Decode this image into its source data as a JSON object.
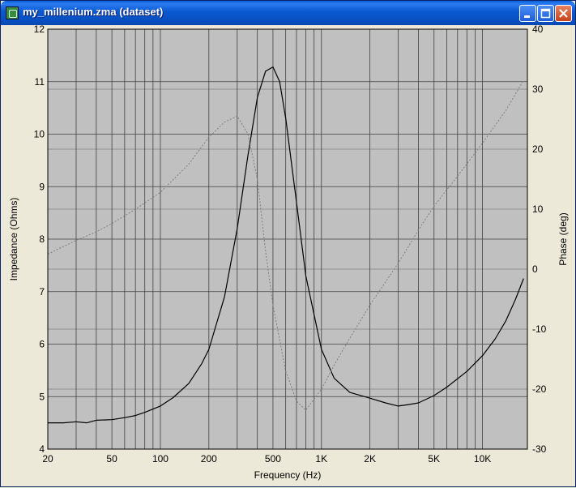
{
  "window": {
    "title": "my_millenium.zma (dataset)",
    "icons": [
      "app-icon",
      "minimize-icon",
      "maximize-icon",
      "close-icon"
    ]
  },
  "colors": {
    "plot_bg": "#C0C0C0",
    "grid": "#404040",
    "impedance_line": "#000000",
    "phase_line": "#808080",
    "titlebar": "#0A58D0"
  },
  "chart_data": {
    "type": "line",
    "xlabel": "Frequency (Hz)",
    "ylabel": "Impedance (Ohms)",
    "y2label": "Phase (deg)",
    "x_scale": "log",
    "xlim": [
      20,
      19000
    ],
    "ylim": [
      4,
      12
    ],
    "y2lim": [
      -30,
      40
    ],
    "grid": true,
    "x_ticks": [
      {
        "v": 20,
        "label": "20"
      },
      {
        "v": 50,
        "label": "50"
      },
      {
        "v": 100,
        "label": "100"
      },
      {
        "v": 200,
        "label": "200"
      },
      {
        "v": 500,
        "label": "500"
      },
      {
        "v": 1000,
        "label": "1K"
      },
      {
        "v": 2000,
        "label": "2K"
      },
      {
        "v": 5000,
        "label": "5K"
      },
      {
        "v": 10000,
        "label": "10K"
      }
    ],
    "y_ticks": [
      {
        "v": 4,
        "label": "4"
      },
      {
        "v": 5,
        "label": "5"
      },
      {
        "v": 6,
        "label": "6"
      },
      {
        "v": 7,
        "label": "7"
      },
      {
        "v": 8,
        "label": "8"
      },
      {
        "v": 9,
        "label": "9"
      },
      {
        "v": 10,
        "label": "10"
      },
      {
        "v": 11,
        "label": "11"
      },
      {
        "v": 12,
        "label": "12"
      }
    ],
    "y2_ticks": [
      {
        "v": -30,
        "label": "-30"
      },
      {
        "v": -20,
        "label": "-20"
      },
      {
        "v": -10,
        "label": "-10"
      },
      {
        "v": 0,
        "label": "0"
      },
      {
        "v": 10,
        "label": "10"
      },
      {
        "v": 20,
        "label": "20"
      },
      {
        "v": 30,
        "label": "30"
      },
      {
        "v": 40,
        "label": "40"
      }
    ],
    "series": [
      {
        "axis": "left",
        "style": "solid",
        "x": [
          20,
          25,
          30,
          35,
          40,
          50,
          60,
          70,
          80,
          100,
          120,
          150,
          180,
          200,
          250,
          300,
          350,
          400,
          450,
          500,
          550,
          600,
          700,
          800,
          1000,
          1200,
          1500,
          2000,
          2500,
          3000,
          3500,
          4000,
          5000,
          6000,
          8000,
          10000,
          12000,
          14000,
          16000,
          18000
        ],
        "y": [
          4.5,
          4.5,
          4.52,
          4.5,
          4.55,
          4.56,
          4.6,
          4.64,
          4.7,
          4.82,
          4.98,
          5.25,
          5.62,
          5.9,
          6.9,
          8.2,
          9.6,
          10.7,
          11.2,
          11.28,
          11.0,
          10.3,
          8.7,
          7.3,
          5.9,
          5.35,
          5.08,
          4.97,
          4.88,
          4.82,
          4.85,
          4.88,
          5.02,
          5.18,
          5.48,
          5.78,
          6.1,
          6.45,
          6.85,
          7.25
        ]
      },
      {
        "axis": "right",
        "style": "dotted",
        "x": [
          20,
          30,
          40,
          50,
          70,
          100,
          150,
          200,
          250,
          300,
          350,
          400,
          450,
          500,
          600,
          700,
          800,
          1000,
          1200,
          1500,
          2000,
          3000,
          4000,
          5000,
          7000,
          10000,
          14000,
          18000
        ],
        "y": [
          2.5,
          4.8,
          6.2,
          7.6,
          10.0,
          12.8,
          17.5,
          22.0,
          24.5,
          25.5,
          22.5,
          15.0,
          3.0,
          -6.0,
          -17.0,
          -22.0,
          -23.5,
          -20.0,
          -16.0,
          -11.5,
          -6.0,
          1.0,
          6.5,
          10.5,
          15.5,
          21.0,
          26.5,
          31.5
        ]
      }
    ]
  }
}
